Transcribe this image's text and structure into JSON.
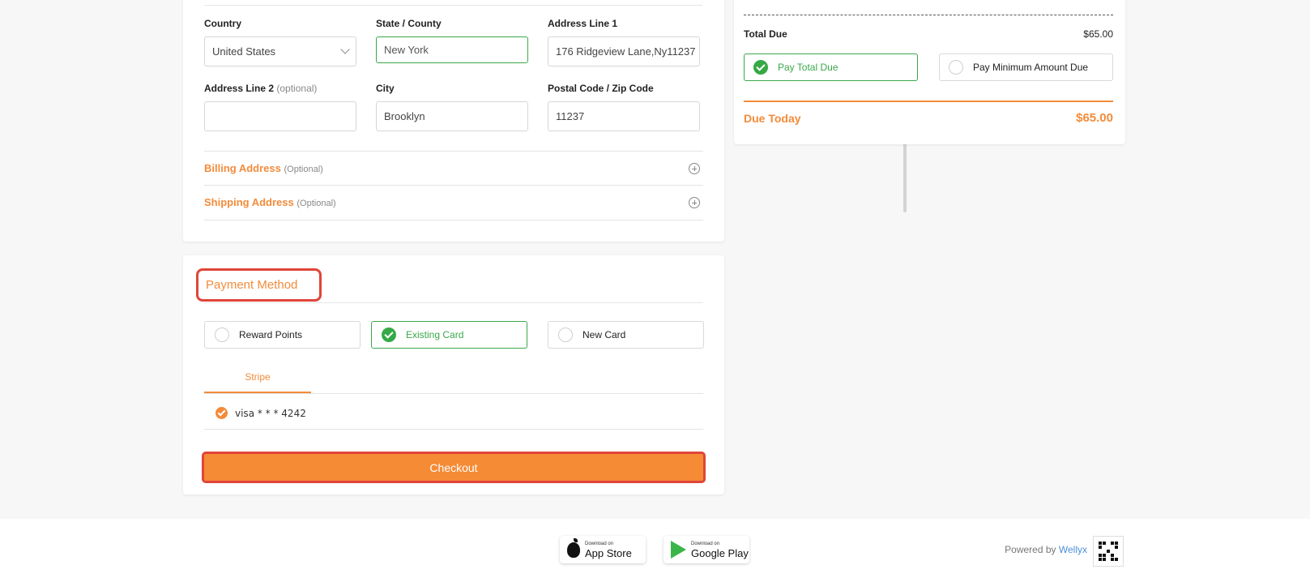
{
  "address": {
    "country_label": "Country",
    "country_value": "United States",
    "state_label": "State / County",
    "state_value": "New York",
    "addr1_label": "Address Line 1",
    "addr1_value": "176 Ridgeview Lane,Ny11237",
    "addr2_label": "Address Line 2",
    "addr2_optional": "(optional)",
    "addr2_value": "",
    "city_label": "City",
    "city_value": "Brooklyn",
    "postal_label": "Postal Code / Zip Code",
    "postal_value": "11237"
  },
  "accordions": [
    {
      "title": "Billing Address",
      "optional": "(Optional)"
    },
    {
      "title": "Shipping Address",
      "optional": "(Optional)"
    }
  ],
  "payment": {
    "title": "Payment Method",
    "options": [
      "Reward Points",
      "Existing Card",
      "New Card"
    ],
    "selected_option": "Existing Card",
    "tab": "Stripe",
    "card": "visa * * * 4242",
    "checkout_label": "Checkout"
  },
  "summary": {
    "total_due_label": "Total Due",
    "total_due_value": "$65.00",
    "pay_total_label": "Pay Total Due",
    "pay_min_label": "Pay Minimum Amount Due",
    "due_today_label": "Due Today",
    "due_today_value": "$65.00"
  },
  "footer": {
    "appstore_small": "Download on",
    "appstore_big": "App Store",
    "googleplay_small": "Download on",
    "googleplay_big": "Google Play",
    "powered_by": "Powered by",
    "brand": "Wellyx"
  },
  "colors": {
    "accent_orange": "#f38b3a",
    "selected_green": "#36a946",
    "highlight_red": "#e0453a"
  }
}
